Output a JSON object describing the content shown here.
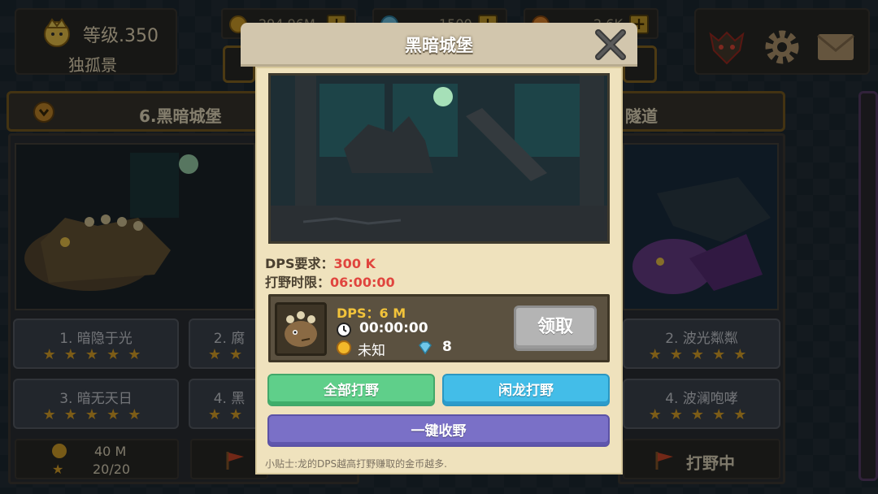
{
  "player": {
    "level": "等级.350",
    "name": "独孤景"
  },
  "resources": [
    {
      "icon": "gold-coin-icon",
      "value": "294.96M"
    },
    {
      "icon": "diamond-icon",
      "value": "1500"
    },
    {
      "icon": "orange-gem-icon",
      "value": "2.6K"
    }
  ],
  "cards": [
    {
      "title": "6.黑暗城堡",
      "stages": [
        "1. 暗隐于光",
        "2. 腐",
        "3. 暗无天日",
        "4. 黑"
      ],
      "reward": {
        "coins": "40 M",
        "stars": "20/20"
      }
    },
    {
      "title": "隧道",
      "stages": [
        "2. 波光粼粼",
        "4. 波澜咆哮"
      ],
      "status": "打野中"
    }
  ],
  "modal": {
    "title": "黑暗城堡",
    "dps_req_label": "DPS要求：",
    "dps_req_value": "300 K",
    "time_limit_label": "打野时限：",
    "time_limit_value": "06:00:00",
    "dragon": {
      "dps": "DPS：6 M",
      "timer": "00:00:00",
      "reward_label": "未知",
      "gem_count": "8",
      "collect_label": "领取"
    },
    "buttons": {
      "all_hunt": "全部打野",
      "idle_hunt": "闲龙打野",
      "collect_all": "一键收野"
    },
    "tip": "小贴士:龙的DPS越高打野赚取的金币越多."
  },
  "colors": {
    "accent_gold": "#c99f2a",
    "req_red": "#e0453e",
    "green_btn": "#5fcf8a",
    "blue_btn": "#43bde8",
    "purple_btn": "#7a70c7"
  }
}
